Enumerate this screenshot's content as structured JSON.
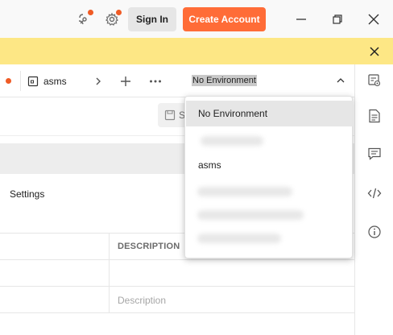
{
  "titlebar": {
    "signin_label": "Sign In",
    "create_account_label": "Create Account",
    "accent_color": "#ff6c37"
  },
  "tabs": {
    "active_tab_label": "asms"
  },
  "environment": {
    "selected_label": "No Environment",
    "options": [
      {
        "label": "No Environment",
        "selected": true
      },
      {
        "label": "",
        "blurred": true
      },
      {
        "label": "asms",
        "selected": false
      },
      {
        "label": "",
        "blurred": true
      },
      {
        "label": "",
        "blurred": true
      },
      {
        "label": "",
        "blurred": true
      }
    ]
  },
  "main": {
    "save_label": "S",
    "settings_tab_label": "Settings",
    "table": {
      "description_header": "DESCRIPTION",
      "description_placeholder": "Description"
    }
  },
  "icons": {
    "titlebar": [
      "satellite-icon",
      "settings-icon",
      "minimize-icon",
      "maximize-icon",
      "close-icon"
    ],
    "sidebar": [
      "environment-quick-look-icon",
      "documentation-icon",
      "comments-icon",
      "code-icon",
      "info-icon"
    ]
  }
}
